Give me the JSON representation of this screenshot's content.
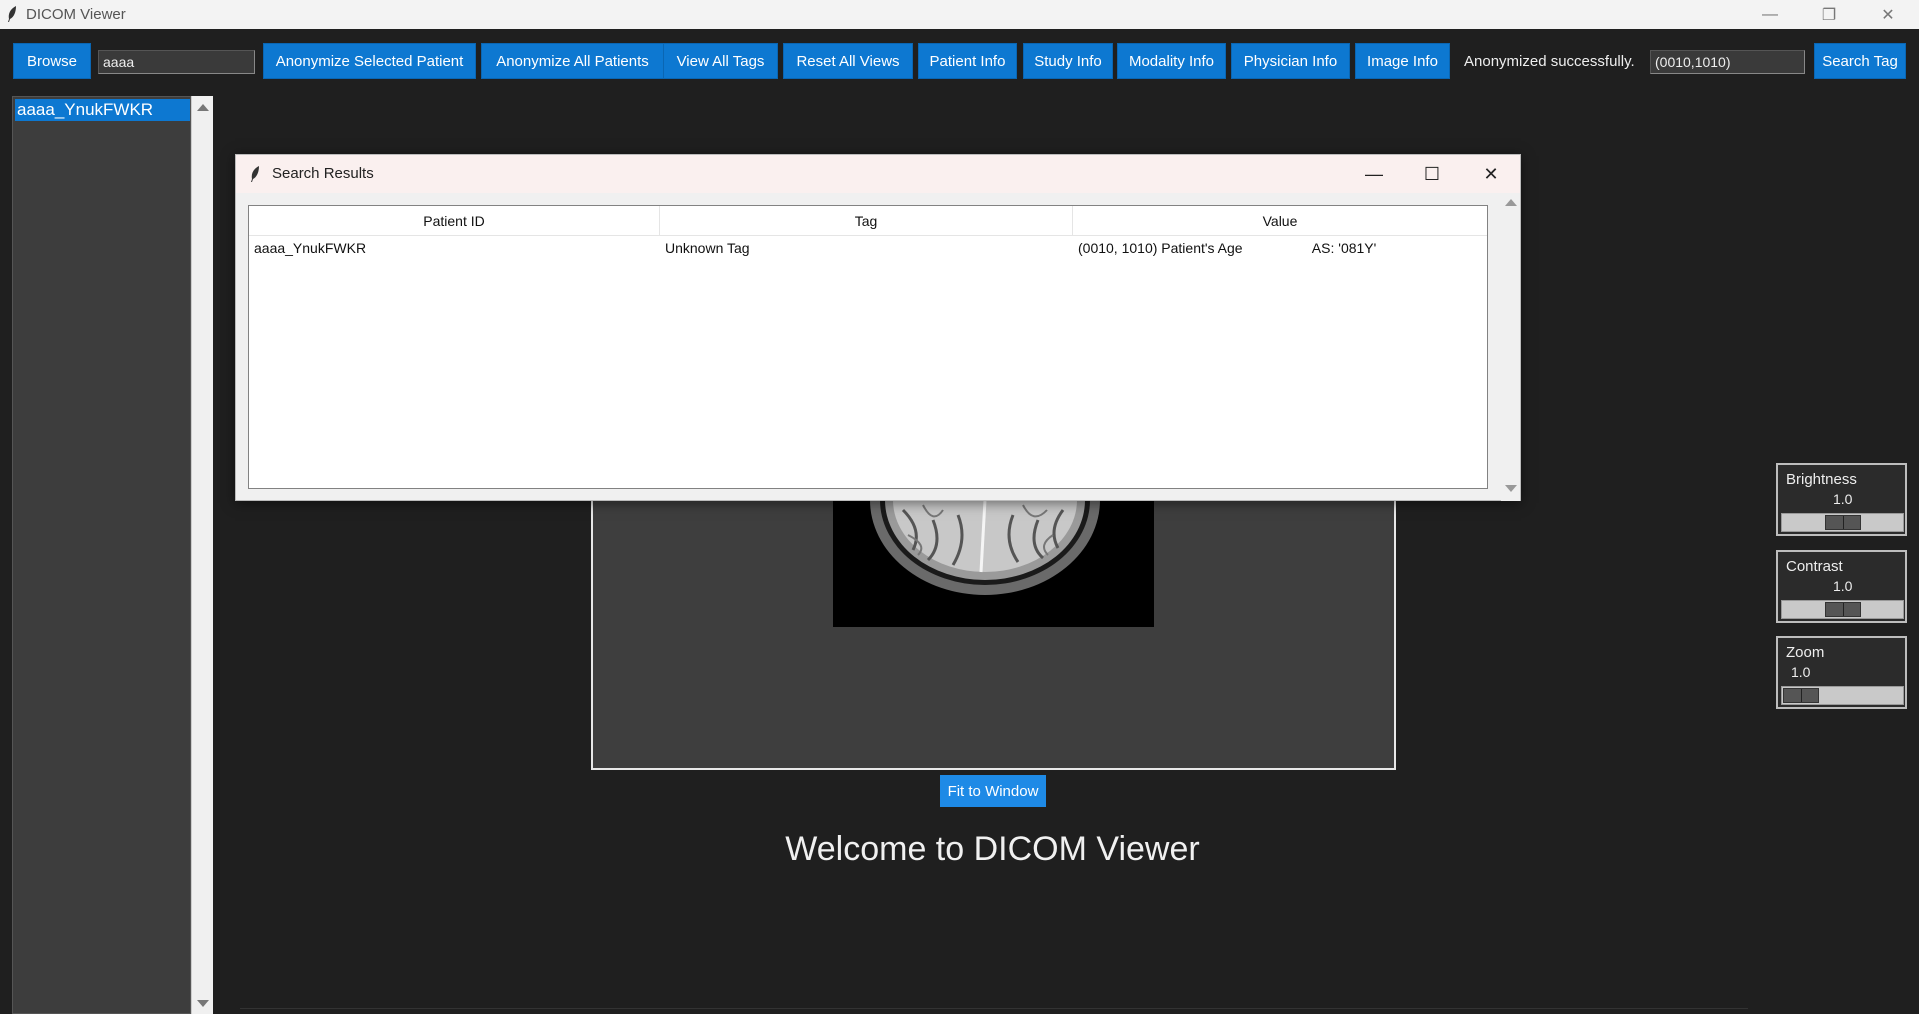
{
  "window": {
    "title": "DICOM Viewer",
    "controls": {
      "minimize": "—",
      "restore": "❐",
      "close": "✕"
    }
  },
  "toolbar": {
    "browse": "Browse",
    "search_value": "aaaa",
    "anonymize_selected": "Anonymize Selected Patient",
    "anonymize_all": "Anonymize All Patients",
    "view_all_tags": "View All Tags",
    "reset_all_views": "Reset All Views",
    "patient_info": "Patient Info",
    "study_info": "Study Info",
    "modality_info": "Modality Info",
    "physician_info": "Physician Info",
    "image_info": "Image Info",
    "status": "Anonymized successfully.",
    "tag_value": "(0010,1010)",
    "search_tag": "Search Tag"
  },
  "patients": [
    "aaaa_YnukFWKR"
  ],
  "dialog": {
    "title": "Search Results",
    "columns": [
      "Patient ID",
      "Tag",
      "Value"
    ],
    "rows": [
      {
        "patient_id": "aaaa_YnukFWKR",
        "tag": "Unknown Tag",
        "value": "(0010, 1010) Patient's Age                  AS: '081Y'"
      }
    ],
    "controls": {
      "minimize": "—",
      "maximize": "☐",
      "close": "✕"
    }
  },
  "viewer": {
    "fit_to_window": "Fit to Window",
    "welcome": "Welcome to DICOM Viewer"
  },
  "sliders": {
    "brightness": {
      "label": "Brightness",
      "value": "1.0"
    },
    "contrast": {
      "label": "Contrast",
      "value": "1.0"
    },
    "zoom": {
      "label": "Zoom",
      "value": "1.0"
    }
  },
  "colors": {
    "accent": "#0d78d1",
    "background": "#1f1f1f"
  }
}
